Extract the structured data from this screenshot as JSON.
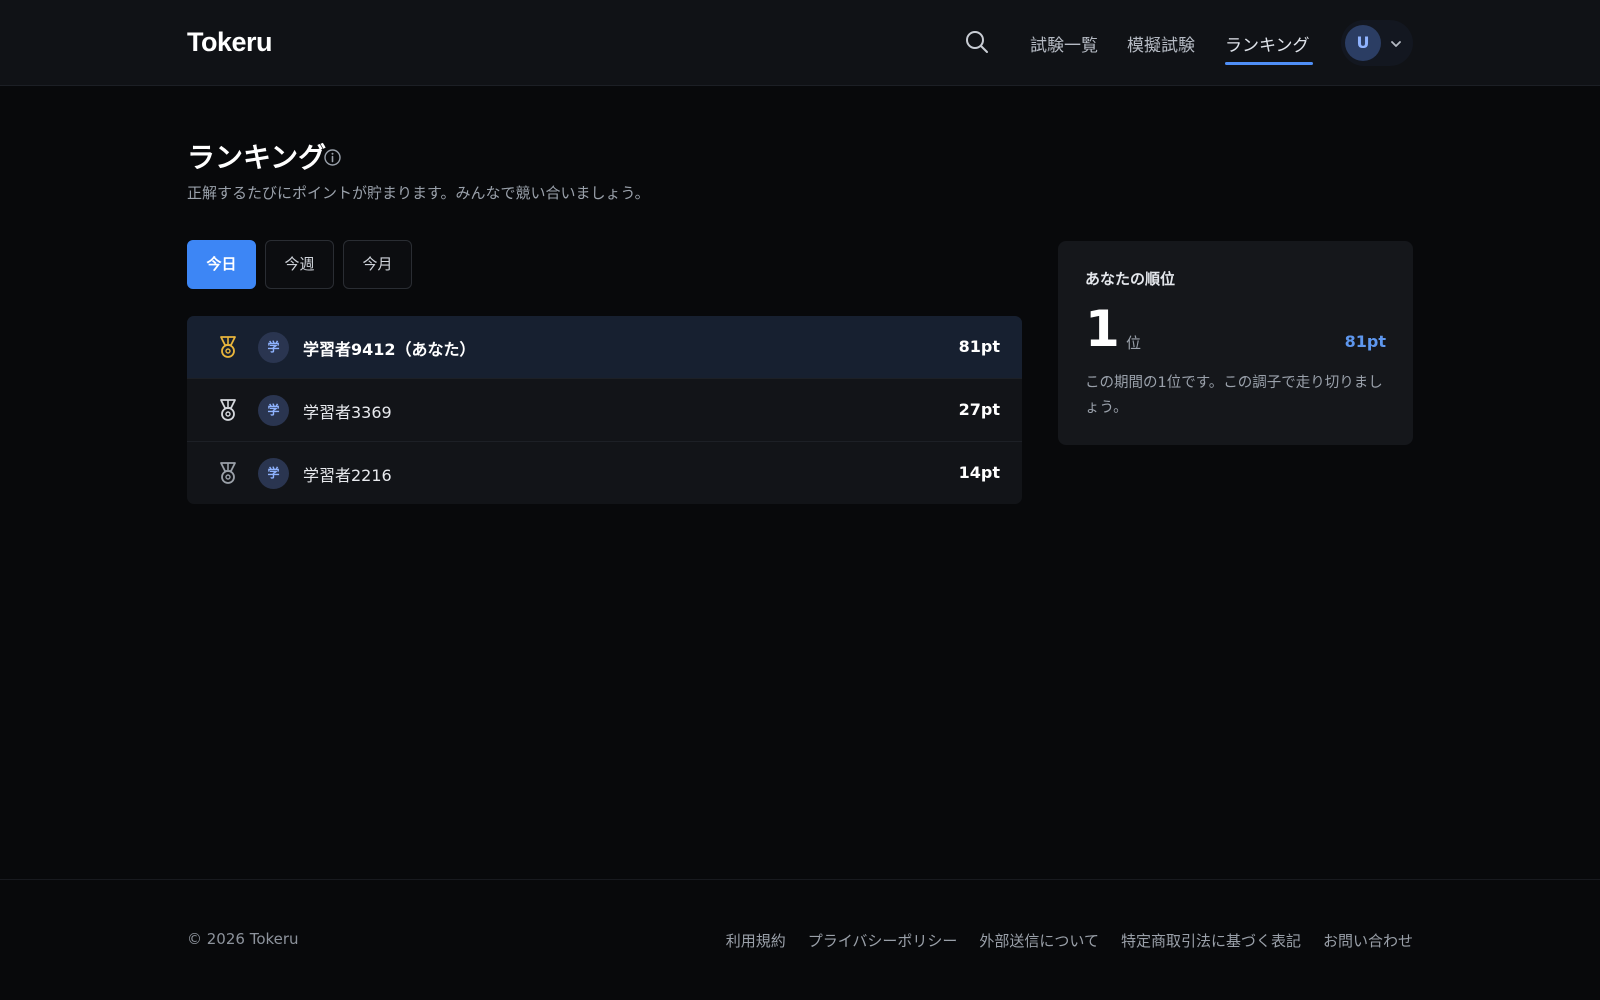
{
  "header": {
    "logo": "Tokeru",
    "nav": [
      {
        "label": "試験一覧"
      },
      {
        "label": "模擬試験"
      },
      {
        "label": "ランキング",
        "active": true
      }
    ],
    "user_initial": "U"
  },
  "main": {
    "title": "ランキング",
    "subtitle": "正解するたびにポイントが貯まります。みんなで競い合いましょう。",
    "tabs": [
      {
        "label": "今日",
        "active": true
      },
      {
        "label": "今週"
      },
      {
        "label": "今月"
      }
    ],
    "ranking": [
      {
        "rank": 1,
        "medal": "gold",
        "avatar": "学",
        "name": "学習者9412（あなた）",
        "points": "81pt",
        "is_me": true
      },
      {
        "rank": 2,
        "medal": "silver",
        "avatar": "学",
        "name": "学習者3369",
        "points": "27pt"
      },
      {
        "rank": 3,
        "medal": "bronze",
        "avatar": "学",
        "name": "学習者2216",
        "points": "14pt"
      }
    ]
  },
  "my_rank": {
    "label": "あなたの順位",
    "rank": "1",
    "unit": "位",
    "points": "81pt",
    "message": "この期間の1位です。この調子で走り切りましょう。"
  },
  "footer": {
    "copyright": "© 2026 Tokeru",
    "links": [
      {
        "label": "利用規約"
      },
      {
        "label": "プライバシーポリシー"
      },
      {
        "label": "外部送信について"
      },
      {
        "label": "特定商取引法に基づく表記"
      },
      {
        "label": "お問い合わせ"
      }
    ]
  },
  "colors": {
    "accent": "#3d86f5",
    "gold_medal": "#e9b53c",
    "silver_medal": "#d4d7dc",
    "bronze_medal": "#9aa0a8",
    "points_highlight": "#5e97ee"
  },
  "icons": {
    "search": "search-icon",
    "info": "info-icon",
    "chevron": "chevron-down-icon",
    "medal": "medal-icon"
  }
}
